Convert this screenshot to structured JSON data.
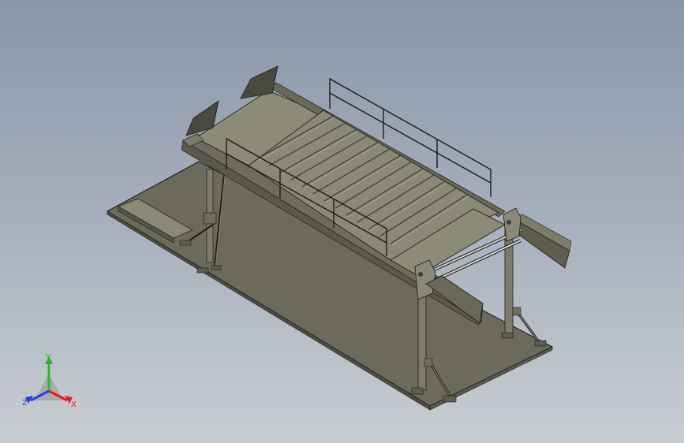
{
  "viewport": {
    "background_top": "#8a96a8",
    "background_bottom": "#c9cdd2"
  },
  "model": {
    "part_color": "#7d7c6a",
    "part_dark": "#5e5d4f",
    "part_light": "#9a9986",
    "edge_color": "#1a1a1a"
  },
  "triad": {
    "x_label": "X",
    "y_label": "Y",
    "z_label": "Z",
    "x_color": "#e0201c",
    "y_color": "#2fb52f",
    "z_color": "#2a3fd6"
  }
}
